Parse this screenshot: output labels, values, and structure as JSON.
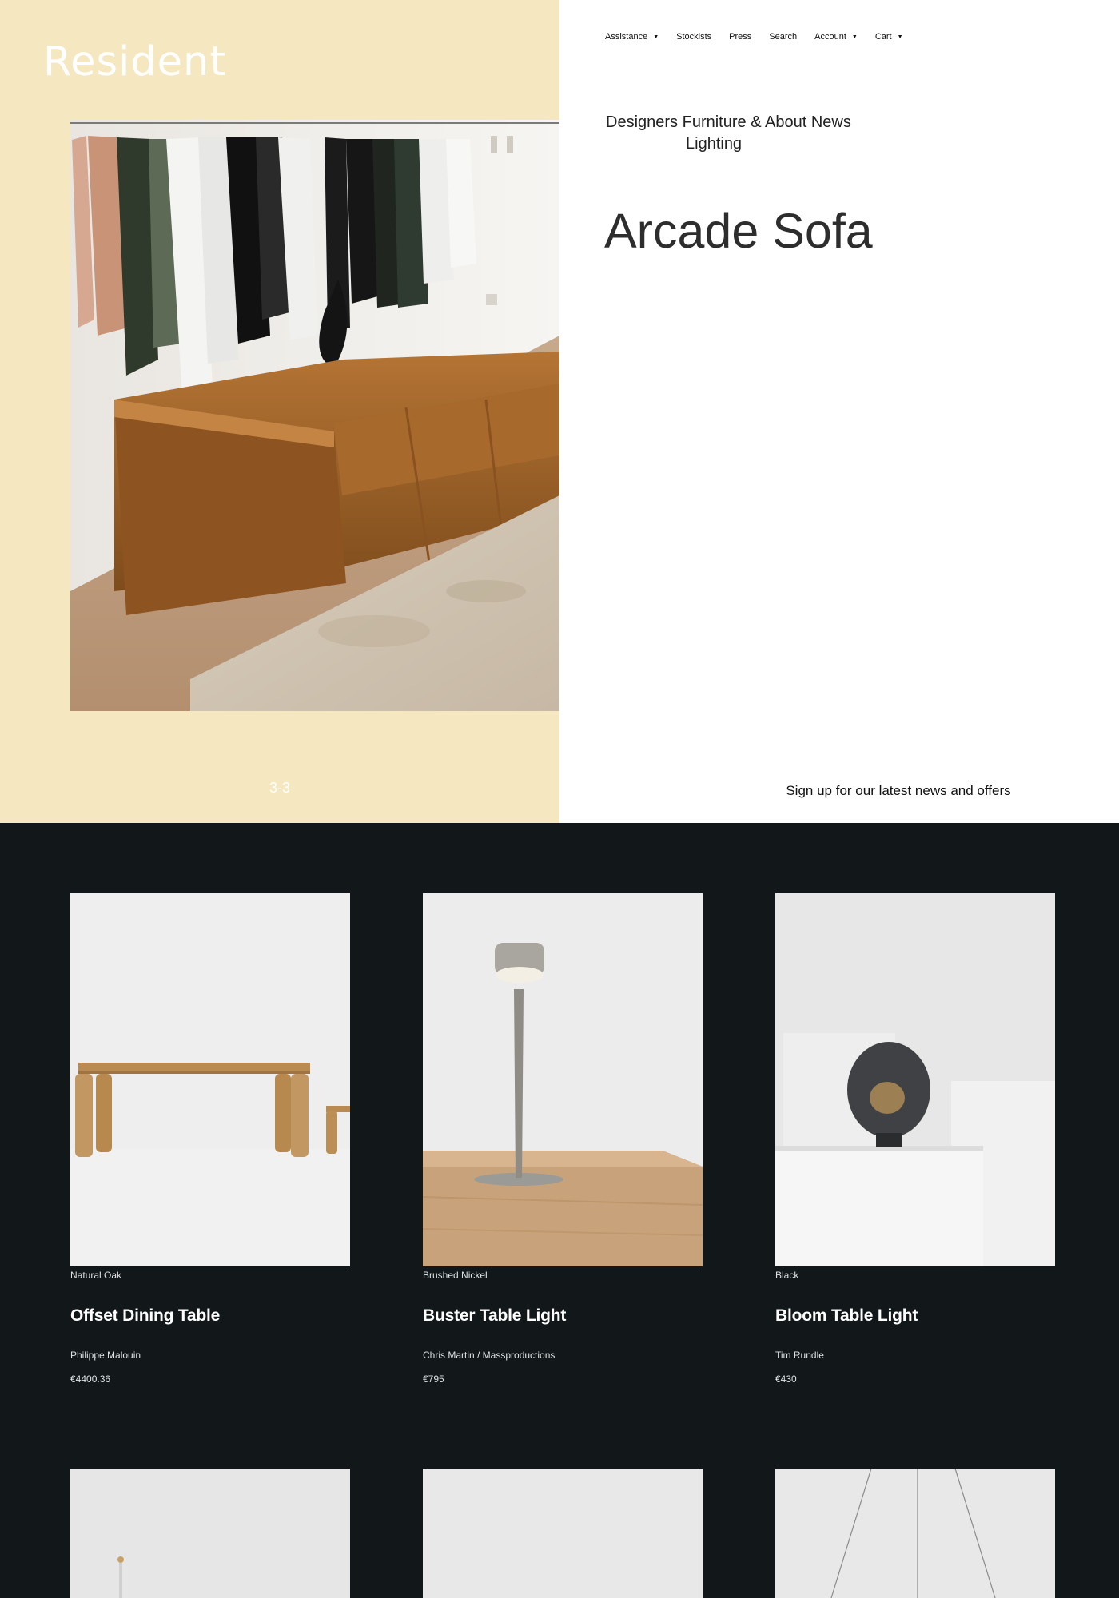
{
  "brand": {
    "logo": "Resident"
  },
  "utility_nav": [
    {
      "label": "Assistance",
      "dropdown": true
    },
    {
      "label": "Stockists",
      "dropdown": false
    },
    {
      "label": "Press",
      "dropdown": false
    },
    {
      "label": "Search",
      "dropdown": false
    },
    {
      "label": "Account",
      "dropdown": true
    },
    {
      "label": "Cart",
      "dropdown": true
    }
  ],
  "main_nav": {
    "designers": "Designers",
    "furniture": "Furniture &",
    "lighting": "Lighting",
    "about": "About",
    "news": "News"
  },
  "product": {
    "title": "Arcade Sofa"
  },
  "slider": {
    "counter": "3-3"
  },
  "newsletter": {
    "cta": "Sign up for our latest news and offers"
  },
  "colors": {
    "left_panel": "#f5e7c0",
    "dark_section": "#121719",
    "right_panel": "#ffffff"
  },
  "products": [
    {
      "variant": "Natural Oak",
      "name": "Offset Dining Table",
      "designer": "Philippe Malouin",
      "price": "€4400.36"
    },
    {
      "variant": "Brushed Nickel",
      "name": "Buster Table Light",
      "designer": "Chris Martin / Massproductions",
      "price": "€795"
    },
    {
      "variant": "Black",
      "name": "Bloom Table Light",
      "designer": "Tim Rundle",
      "price": "€430"
    }
  ]
}
